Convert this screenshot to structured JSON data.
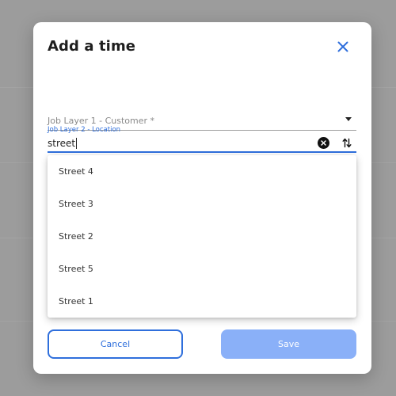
{
  "dialog": {
    "title": "Add a time",
    "close_icon": "close-icon"
  },
  "fields": {
    "customer": {
      "label": "Job Layer 1 - Customer *",
      "value": "",
      "icon": "dropdown-caret-icon"
    },
    "location": {
      "label": "Job Layer 2 - Location",
      "value": "street",
      "clear_icon": "clear-icon",
      "swap_icon": "swap-vertical-icon"
    }
  },
  "dropdown": {
    "options": [
      "Street 4",
      "Street 3",
      "Street 2",
      "Street 5",
      "Street 1"
    ]
  },
  "buttons": {
    "cancel": "Cancel",
    "save": "Save",
    "save_enabled": false
  },
  "colors": {
    "accent": "#2f6fdc",
    "save_disabled": "#8ab0f8",
    "backdrop": "#9c9c9c",
    "text": "#1e1e1e"
  }
}
